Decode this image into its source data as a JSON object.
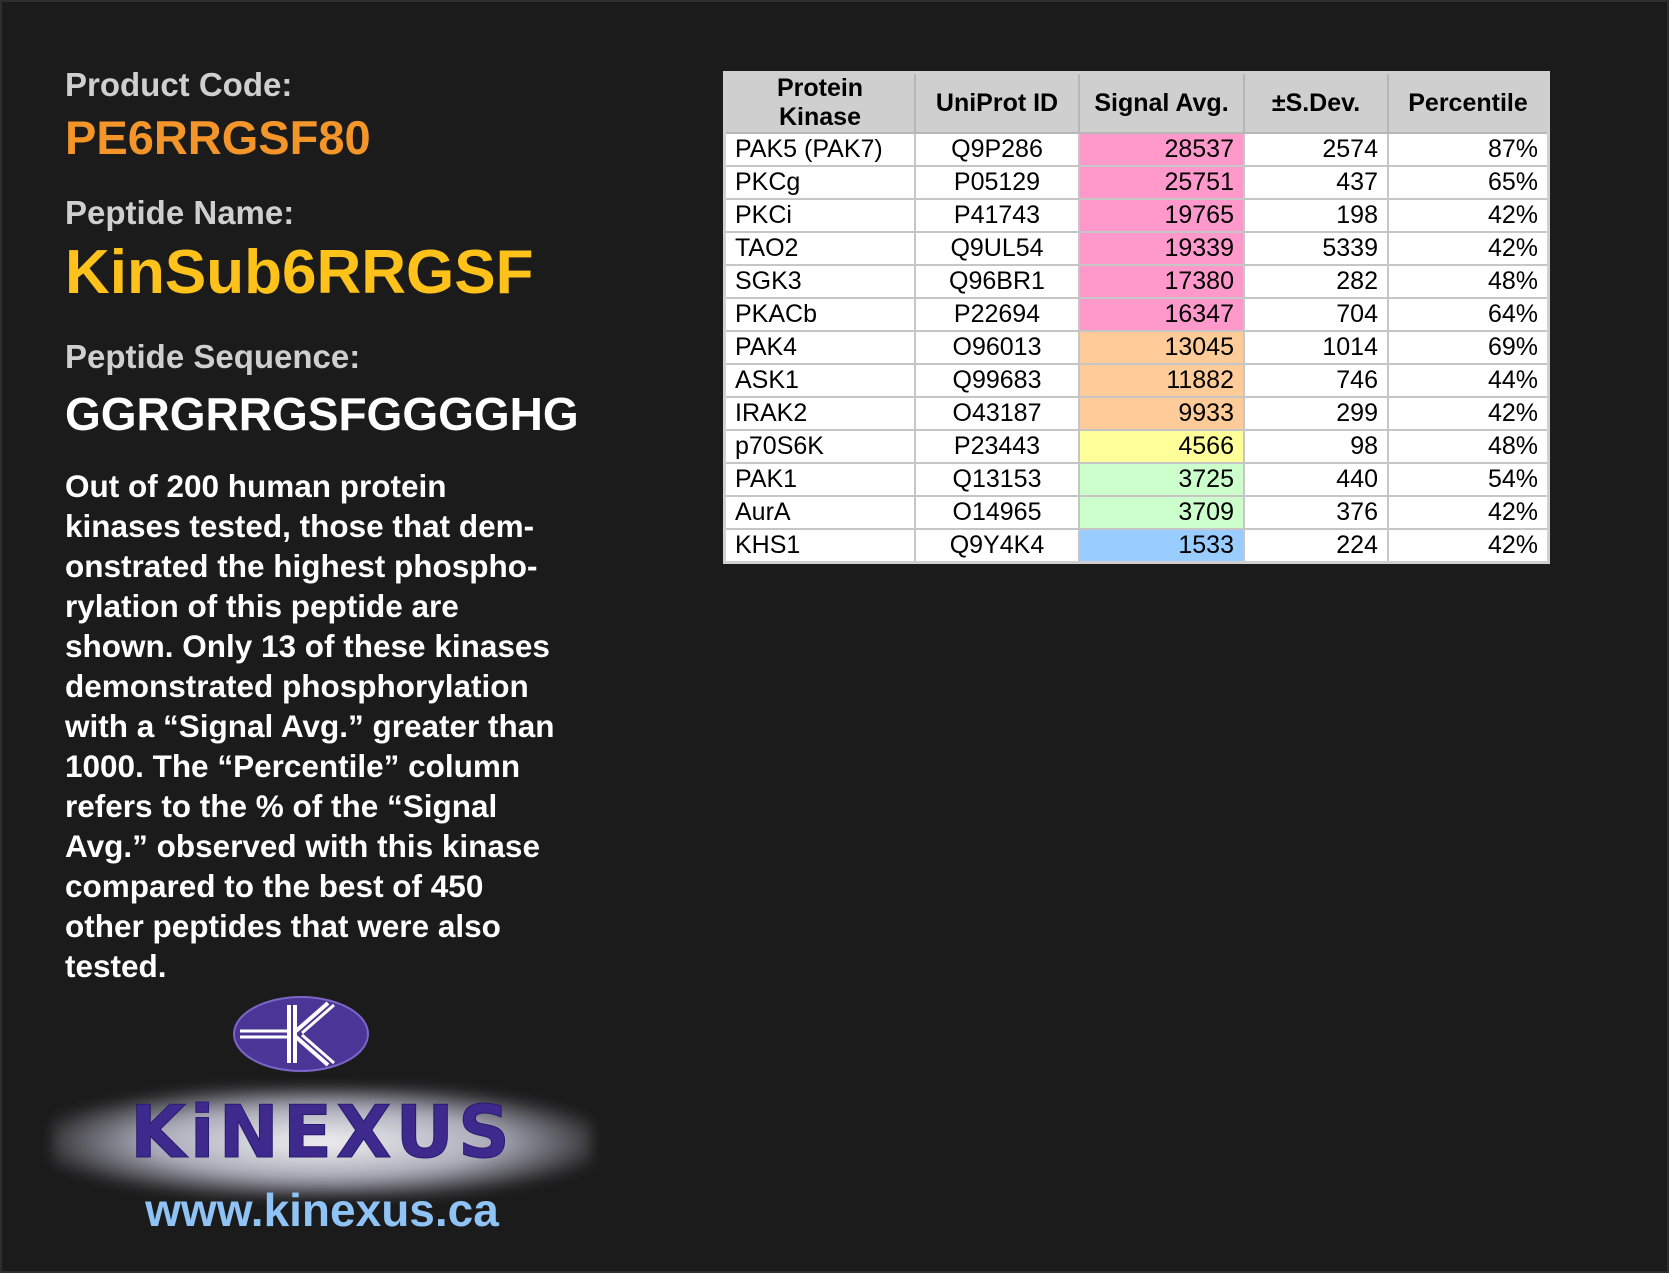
{
  "product": {
    "code_label": "Product Code:",
    "code": "PE6RRGSF80",
    "name_label": "Peptide Name:",
    "name": "KinSub6RRGSF",
    "sequence_label": "Peptide Sequence:",
    "sequence": "GGRGRRGSFGGGGHG",
    "description": "Out of 200 human protein\nkinases tested, those that dem-\nonstrated the highest phospho-\nrylation of this peptide are\nshown. Only 13 of these kinases\ndemonstrated phosphorylation\nwith a “Signal Avg.” greater than\n1000. The “Percentile” column\nrefers to the % of the “Signal\nAvg.” observed with this kinase\ncompared to the best of 450\nother peptides that were also\ntested."
  },
  "logo": {
    "wordmark": "KiNEXUS",
    "url": "www.kinexus.ca",
    "colors": {
      "mark": "#4b3596",
      "word": "#3d2a8c",
      "url": "#8fc3f5"
    }
  },
  "table": {
    "headers": [
      "Protein Kinase",
      "UniProt ID",
      "Signal Avg.",
      "±S.Dev.",
      "Percentile"
    ],
    "rows": [
      {
        "kinase": "PAK5 (PAK7)",
        "uniprot": "Q9P286",
        "signal": "28537",
        "sdev": "2574",
        "percentile": "87%",
        "color": "#ff99cc"
      },
      {
        "kinase": "PKCg",
        "uniprot": "P05129",
        "signal": "25751",
        "sdev": "437",
        "percentile": "65%",
        "color": "#ff99cc"
      },
      {
        "kinase": "PKCi",
        "uniprot": "P41743",
        "signal": "19765",
        "sdev": "198",
        "percentile": "42%",
        "color": "#ff99cc"
      },
      {
        "kinase": "TAO2",
        "uniprot": "Q9UL54",
        "signal": "19339",
        "sdev": "5339",
        "percentile": "42%",
        "color": "#ff99cc"
      },
      {
        "kinase": "SGK3",
        "uniprot": "Q96BR1",
        "signal": "17380",
        "sdev": "282",
        "percentile": "48%",
        "color": "#ff99cc"
      },
      {
        "kinase": "PKACb",
        "uniprot": "P22694",
        "signal": "16347",
        "sdev": "704",
        "percentile": "64%",
        "color": "#ff99cc"
      },
      {
        "kinase": "PAK4",
        "uniprot": "O96013",
        "signal": "13045",
        "sdev": "1014",
        "percentile": "69%",
        "color": "#ffcc99"
      },
      {
        "kinase": "ASK1",
        "uniprot": "Q99683",
        "signal": "11882",
        "sdev": "746",
        "percentile": "44%",
        "color": "#ffcc99"
      },
      {
        "kinase": "IRAK2",
        "uniprot": "O43187",
        "signal": "9933",
        "sdev": "299",
        "percentile": "42%",
        "color": "#ffcc99"
      },
      {
        "kinase": "p70S6K",
        "uniprot": "P23443",
        "signal": "4566",
        "sdev": "98",
        "percentile": "48%",
        "color": "#ffff99"
      },
      {
        "kinase": "PAK1",
        "uniprot": "Q13153",
        "signal": "3725",
        "sdev": "440",
        "percentile": "54%",
        "color": "#ccffcc"
      },
      {
        "kinase": "AurA",
        "uniprot": "O14965",
        "signal": "3709",
        "sdev": "376",
        "percentile": "42%",
        "color": "#ccffcc"
      },
      {
        "kinase": "KHS1",
        "uniprot": "Q9Y4K4",
        "signal": "1533",
        "sdev": "224",
        "percentile": "42%",
        "color": "#99ccff"
      }
    ]
  }
}
